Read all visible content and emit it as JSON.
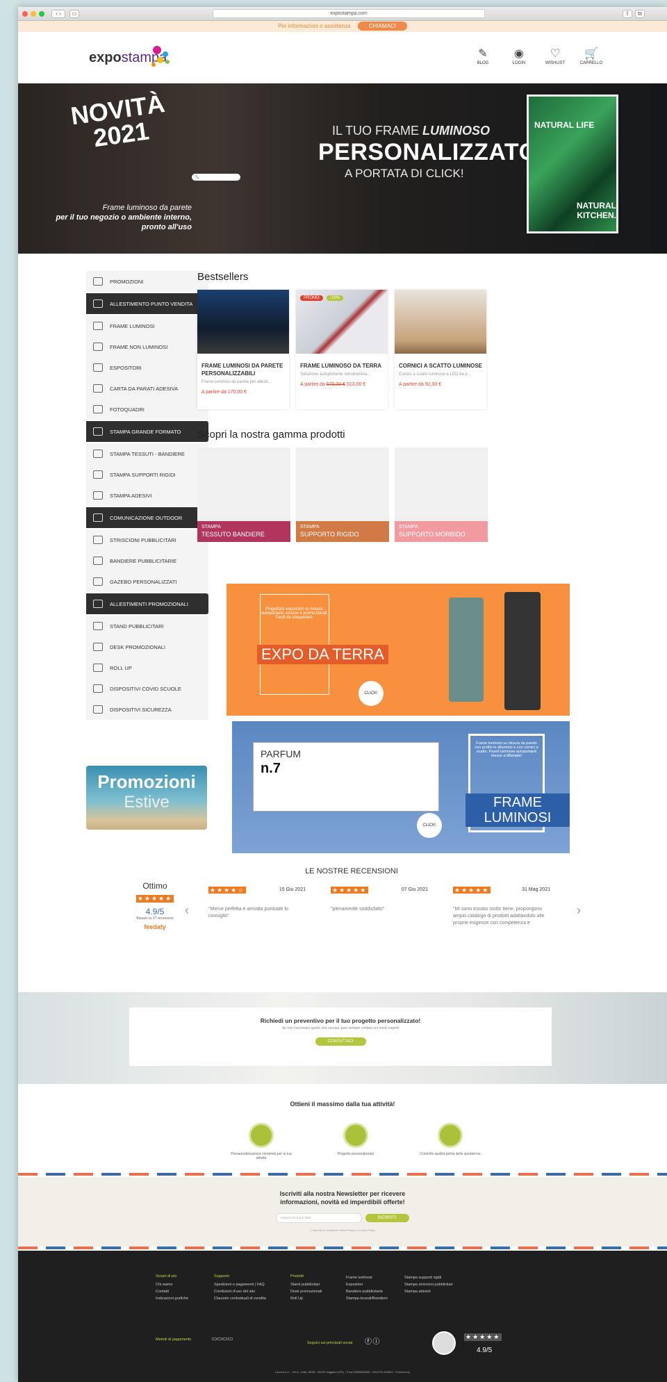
{
  "browser": {
    "url": "expostampa.com"
  },
  "topbar": {
    "info": "Per informazioni o assistenza",
    "call": "CHIAMACI"
  },
  "header": {
    "logo_a": "expo",
    "logo_b": "stampa",
    "icons": [
      {
        "label": "BLOG",
        "icon": "pen-icon"
      },
      {
        "label": "LOGIN",
        "icon": "user-icon"
      },
      {
        "label": "WISHLIST",
        "icon": "heart-icon"
      },
      {
        "label": "CARRELLO",
        "icon": "cart-icon"
      }
    ]
  },
  "hero": {
    "novita": "NOVITÀ",
    "year": "2021",
    "sub_line1": "Frame luminoso da parete",
    "sub_line2": "per il tuo negozio o ambiente interno,",
    "sub_line3": "pronto all'uso",
    "title1a": "IL TUO FRAME ",
    "title1b": "LUMINOSO",
    "title2": "PERSONALIZZATO",
    "title3": "A PORTATA DI CLICK!",
    "lb1": "NATURAL LIFE",
    "lb2": "NATURAL KITCHEN."
  },
  "sidebar": [
    {
      "label": "PROMOZIONI",
      "dark": false
    },
    {
      "label": "ALLESTIMENTO PUNTO VENDITA",
      "dark": true
    },
    {
      "label": "FRAME LUMINOSI",
      "dark": false
    },
    {
      "label": "FRAME NON LUMINOSI",
      "dark": false
    },
    {
      "label": "ESPOSITORI",
      "dark": false
    },
    {
      "label": "CARTA DA PARATI ADESIVA",
      "dark": false
    },
    {
      "label": "FOTOQUADRI",
      "dark": false
    },
    {
      "label": "STAMPA GRANDE FORMATO",
      "dark": true
    },
    {
      "label": "STAMPA TESSUTI - BANDIERE",
      "dark": false
    },
    {
      "label": "STAMPA SUPPORTI RIGIDI",
      "dark": false
    },
    {
      "label": "STAMPA ADESIVI",
      "dark": false
    },
    {
      "label": "COMUNICAZIONE OUTDOOR",
      "dark": true
    },
    {
      "label": "STRISCIONI PUBBLICITARI",
      "dark": false
    },
    {
      "label": "BANDIERE PUBBLICITARIE",
      "dark": false
    },
    {
      "label": "GAZEBO PERSONALIZZATI",
      "dark": false
    },
    {
      "label": "ALLESTIMENTI PROMOZIONALI",
      "dark": true
    },
    {
      "label": "STAND PUBBLICITARI",
      "dark": false
    },
    {
      "label": "DESK PROMOZIONALI",
      "dark": false
    },
    {
      "label": "ROLL UP",
      "dark": false
    },
    {
      "label": "DISPOSITIVI COVID SCUOLE",
      "dark": false
    },
    {
      "label": "DISPOSITIVI SICUREZZA",
      "dark": false
    }
  ],
  "promo_banner": {
    "a": "Promozioni",
    "b": "Estive"
  },
  "bestsellers": {
    "title": "Bestsellers",
    "items": [
      {
        "name": "FRAME LUMINOSI DA PARETE PERSONALIZZABILI",
        "desc": "Frame luminosi da parete per allesti...",
        "price": "A partire da 170,00 €",
        "old": "",
        "color": "#1b3f6e"
      },
      {
        "name": "FRAME LUMINOSO DA TERRA",
        "desc": "Soluzione autoportante retroillumina...",
        "price": "A partire da ",
        "old": "570,00 €",
        "new": " 513,00 €",
        "color": "#c9cfd6"
      },
      {
        "name": "CORNICI A SCATTO LUMINOSE",
        "desc": "Cornici a scatto luminose e LED da p...",
        "price": "A partire da 92,00 €",
        "old": "",
        "color": "#c7a27a"
      }
    ],
    "badge_promo": "PROMO",
    "badge_disc": "-10%"
  },
  "gamma": {
    "title": "Scopri la nostra gamma prodotti",
    "items": [
      {
        "top": "STAMPA",
        "name": "TESSUTO BANDIERE",
        "color": "#b0365e"
      },
      {
        "top": "STAMPA",
        "name": "SUPPORTO RIGIDO",
        "color": "#d27a45"
      },
      {
        "top": "STAMPA",
        "name": "SUPPORTO MORBIDO",
        "color": "#f19aa0"
      }
    ]
  },
  "expo_banner": {
    "text": "Progettato espositori su misura: autoportanti, sinuosi e promozionali. Facili da trasportare.",
    "label": "EXPO DA TERRA",
    "click": "CLICK!"
  },
  "frame_banner": {
    "parfum": "PARFUM",
    "n7": "n.7",
    "text": "Frame luminosi su misura da parete con profilo in alluminio e con cornici a scatto. Pareti luminose autoportanti messe a tiffaniate!",
    "label": "FRAME LUMINOSI",
    "click": "CLICK!"
  },
  "reviews": {
    "title": "LE NOSTRE RECENSIONI",
    "rating_word": "Ottimo",
    "stars": "★★★★★",
    "score": "4.9/5",
    "based": "Basato su 27 recensioni",
    "source": "feedaty",
    "items": [
      {
        "date": "15 Giu 2021",
        "text": "\"Merce perfetta e arrivata puntuale lo consiglio\"",
        "stars": "★★★★☆"
      },
      {
        "date": "07 Giu 2021",
        "text": "\"pienamente soddisfatto\"",
        "stars": "★★★★★"
      },
      {
        "date": "31 Mag 2021",
        "text": "\"Mi sono trovato molto bene, propongono ampio catalogo di prodotti adattandolo alle proprie esigenze con competenza e",
        "stars": "★★★★★"
      }
    ]
  },
  "cta": {
    "title": "Richiedi un preventivo per il tuo progetto personalizzato!",
    "sub": "Se non hai trovato quello che cercavi, puoi sempre contare sui nostri esperti",
    "button": "CONTATTACI"
  },
  "ottieni": {
    "title": "Ottieni il massimo dalla tua attività!",
    "items": [
      "Persaonalizzazione completa per la tua attività",
      "Progetto personalizzato",
      "Controllo qualità prima della spedizione"
    ]
  },
  "newsletter": {
    "title1": "Iscriviti alla nostra Newsletter per ricevere",
    "title2": "informazioni, novità ed imperdibili offerte!",
    "placeholder": "Inserisci la tua E-Mail",
    "button": "ISCRIVITI",
    "privacy": "Accetto le condizioni della Privacy e Cookie Policy"
  },
  "footer": {
    "cols": [
      {
        "head": "Scopri di più",
        "items": [
          "Chi siamo",
          "Contatti",
          "Indicazioni grafiche"
        ]
      },
      {
        "head": "Supporto",
        "items": [
          "Spedizioni e pagamenti | FAQ",
          "Condizioni d'uso del sito",
          "Clausole contrattuali di vendita"
        ]
      },
      {
        "head": "Prodotti",
        "items": [
          "Stand pubblicitari",
          "Desk promozionali",
          "Roll Up"
        ]
      },
      {
        "head": "",
        "items": [
          "Frame luminosi",
          "Espositori",
          "Bandiere pubblicitarie",
          "Stampa tessuti/Bandiere"
        ]
      },
      {
        "head": "",
        "items": [
          "Stampa supporti rigidi",
          "Stampa striscioni pubblicitari",
          "Stampa adesivi"
        ]
      }
    ],
    "pay": "Metodi di pagamento",
    "social": "Seguici sui principali social",
    "score": "4.9/5",
    "copy": "Lucenti s.r.l. - Via A. Volta, 36/38 - 59100 Vaggiano (PD) - P.iva 03650580288 - REA PD-318653 - Powered by"
  }
}
